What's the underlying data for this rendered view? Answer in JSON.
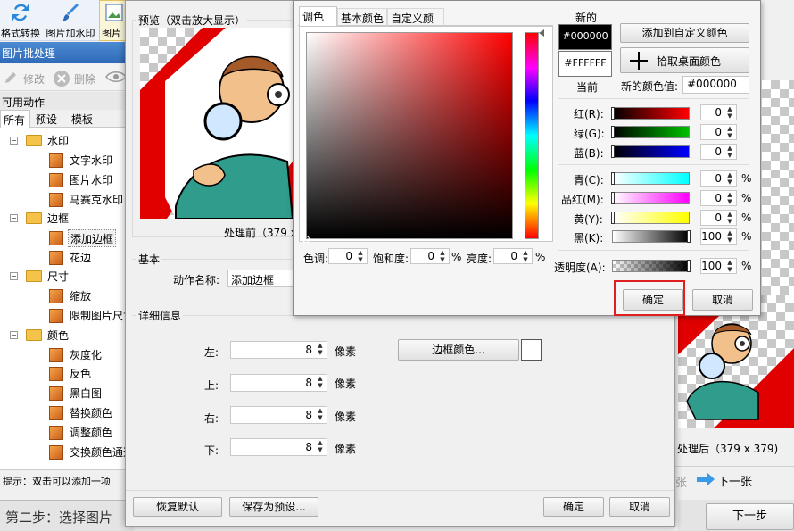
{
  "toolbar": {
    "format_convert": "格式转换",
    "image_watermark": "图片加水印",
    "partial": "图片"
  },
  "app_title": "图片批处理",
  "subtoolbar": {
    "edit": "修改",
    "delete": "删除"
  },
  "left": {
    "section_title": "可用动作",
    "tabs": [
      "所有",
      "预设",
      "模板"
    ],
    "status": "提示：双击可以添加一项"
  },
  "tree": {
    "watermark": "水印",
    "text_watermark": "文字水印",
    "image_watermark": "图片水印",
    "mosaic_watermark": "马赛克水印",
    "border": "边框",
    "add_border": "添加边框",
    "pattern_border": "花边",
    "size": "尺寸",
    "scale": "缩放",
    "limit_size": "限制图片尺寸",
    "color": "颜色",
    "grayscale": "灰度化",
    "invert": "反色",
    "bw": "黑白图",
    "replace_color": "替换颜色",
    "adjust_color": "调整颜色",
    "swap_channel": "交换颜色通道"
  },
  "bottom": {
    "step_text": "第二步：选择图片",
    "next_step": "下一步",
    "next_image": "下一张",
    "prev_partial": "张"
  },
  "dialog": {
    "preview_label": "预览（双击放大显示）",
    "before_caption": "处理前（379 x 3",
    "basic_label": "基本",
    "action_name_label": "动作名称:",
    "action_name_value": "添加边框",
    "details_label": "详细信息",
    "left_label": "左:",
    "top_label": "上:",
    "right_label": "右:",
    "bottom_label": "下:",
    "left_value": "8",
    "top_value": "8",
    "right_value": "8",
    "bottom_value": "8",
    "unit": "像素",
    "border_color_btn": "边框颜色...",
    "reset_btn": "恢复默认",
    "save_preset_btn": "保存为预设...",
    "ok_btn": "确定",
    "cancel_btn": "取消"
  },
  "right_panel": {
    "after_caption": "处理后（379 x 379)"
  },
  "color_dialog": {
    "tabs": [
      "调色板",
      "基本颜色",
      "自定义颜色"
    ],
    "new_label": "新的",
    "current_label": "当前",
    "new_color_text": "#000000",
    "current_color_text": "#FFFFFF",
    "add_custom_btn": "添加到自定义颜色",
    "pick_screen_btn": "拾取桌面颜色",
    "new_value_label": "新的颜色值:",
    "new_value": "#000000",
    "red_label": "红(R):",
    "green_label": "绿(G):",
    "blue_label": "蓝(B):",
    "cyan_label": "青(C):",
    "magenta_label": "品红(M):",
    "yellow_label": "黄(Y):",
    "black_label": "黑(K):",
    "alpha_label": "透明度(A):",
    "red_value": "0",
    "green_value": "0",
    "blue_value": "0",
    "cyan_value": "0",
    "magenta_value": "0",
    "yellow_value": "0",
    "black_value": "100",
    "alpha_value": "100",
    "hue_label": "色调:",
    "sat_label": "饱和度:",
    "lum_label": "亮度:",
    "hue_value": "0",
    "sat_value": "0",
    "lum_value": "0",
    "percent": "%",
    "ok_btn": "确定",
    "cancel_btn": "取消",
    "colors": {
      "new": "#000000",
      "current": "#FFFFFF",
      "highlight": "#e02020"
    }
  }
}
